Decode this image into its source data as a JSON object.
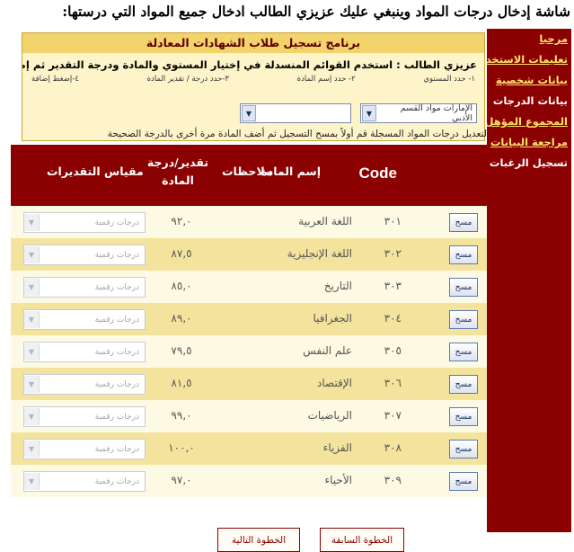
{
  "caption": "شاشة إدخال درجات المواد وينبغي عليك عزيزي الطالب ادخال جميع المواد التي درستها:",
  "sidebar": {
    "items": [
      {
        "label": "مرحبا",
        "active": false
      },
      {
        "label": "تعليمات الاستخدام",
        "active": false
      },
      {
        "label": "بيانات شخصية",
        "active": false
      },
      {
        "label": "بيانات الدرجات",
        "active": true
      },
      {
        "label": "المجموع المؤهل",
        "active": false
      },
      {
        "label": "مراجعة البيانات",
        "active": false
      },
      {
        "label": "تسجيل الرغبات",
        "active": true
      }
    ]
  },
  "form": {
    "title": "برنامج تسجيل طلاب الشهادات المعادلة",
    "instruction": "عزيزي الطالب : استخدم القوائم المنسدلة في إختيار المستوي والمادة ودرجة التقدير ثم إضغط مفتاح الإضافة",
    "steps": [
      "١- حدد المستوي",
      "٢- حدد إسم المادة",
      "٣-حدد درجة / تقدير المادة",
      "٤-إضغط إضافة"
    ],
    "level_select": "الإمارات مواد القسم الأدبي",
    "subject_select": ""
  },
  "hint": "لتعديل درجات المواد المسجلة قم أولاً بمسح التسجيل ثم أضف المادة مرة أخرى بالدرجة الصحيحة",
  "table": {
    "headers": {
      "code": "Code",
      "subject": "إسم المادة",
      "notes": "ملاحظات",
      "grade": "تقدير/درجة المادة",
      "scale": "مقياس التقديرات"
    },
    "delete_label": "مسح",
    "scale_placeholder": "درجات رقمية",
    "rows": [
      {
        "code": "٣٠١",
        "subject": "اللغة العربية",
        "grade": "٩٢,٠"
      },
      {
        "code": "٣٠٢",
        "subject": "اللغة الإنجليزية",
        "grade": "٨٧,٥"
      },
      {
        "code": "٣٠٣",
        "subject": "التاريخ",
        "grade": "٨٥,٠"
      },
      {
        "code": "٣٠٤",
        "subject": "الجغرافيا",
        "grade": "٨٩,٠"
      },
      {
        "code": "٣٠٥",
        "subject": "علم النفس",
        "grade": "٧٩,٥"
      },
      {
        "code": "٣٠٦",
        "subject": "الإقتصاد",
        "grade": "٨١,٥"
      },
      {
        "code": "٣٠٧",
        "subject": "الرياضيات",
        "grade": "٩٩,٠"
      },
      {
        "code": "٣٠٨",
        "subject": "الفزياء",
        "grade": "١٠٠,٠"
      },
      {
        "code": "٣٠٩",
        "subject": "الأحياء",
        "grade": "٩٧,٠"
      }
    ]
  },
  "nav": {
    "prev_label": "الخطوة السابقة",
    "next_label": "الخطوة التالية"
  },
  "colors": {
    "sidebar": "#8b0000",
    "sidebar_link": "#ffe36a",
    "header_band": "#8b0000",
    "row_dark": "#f3e39c",
    "row_light": "#fdfae3",
    "form_title": "#f3d36b"
  }
}
